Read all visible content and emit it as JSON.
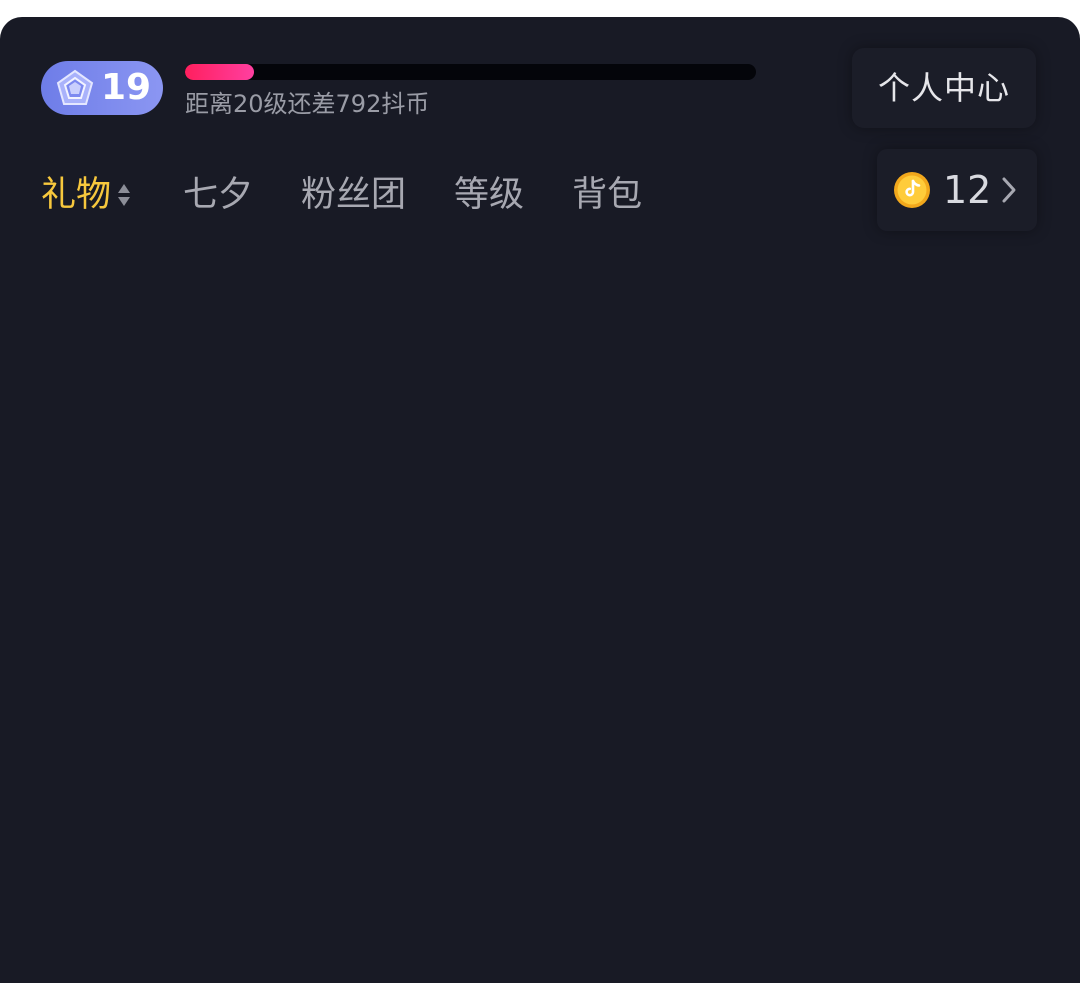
{
  "level": {
    "current": "19",
    "badge_icon": "pentagon-gem-icon",
    "progress_fraction": 0.12,
    "progress_text": "距离20级还差792抖币"
  },
  "header": {
    "personal_center_label": "个人中心"
  },
  "tabs": [
    {
      "label": "礼物",
      "active": true,
      "icon": "sort-arrows-icon"
    },
    {
      "label": "七夕",
      "active": false
    },
    {
      "label": "粉丝团",
      "active": false
    },
    {
      "label": "等级",
      "active": false
    },
    {
      "label": "背包",
      "active": false
    }
  ],
  "balance": {
    "amount": "12",
    "coin_icon": "douyin-coin-icon",
    "more_icon": "chevron-right-icon"
  },
  "colors": {
    "panel_bg": "#181a25",
    "active_tab": "#f7c83d",
    "inactive_tab": "#a7a8b1",
    "progress_fill": "#ff1f5e",
    "badge_bg": "#7b88ee"
  }
}
